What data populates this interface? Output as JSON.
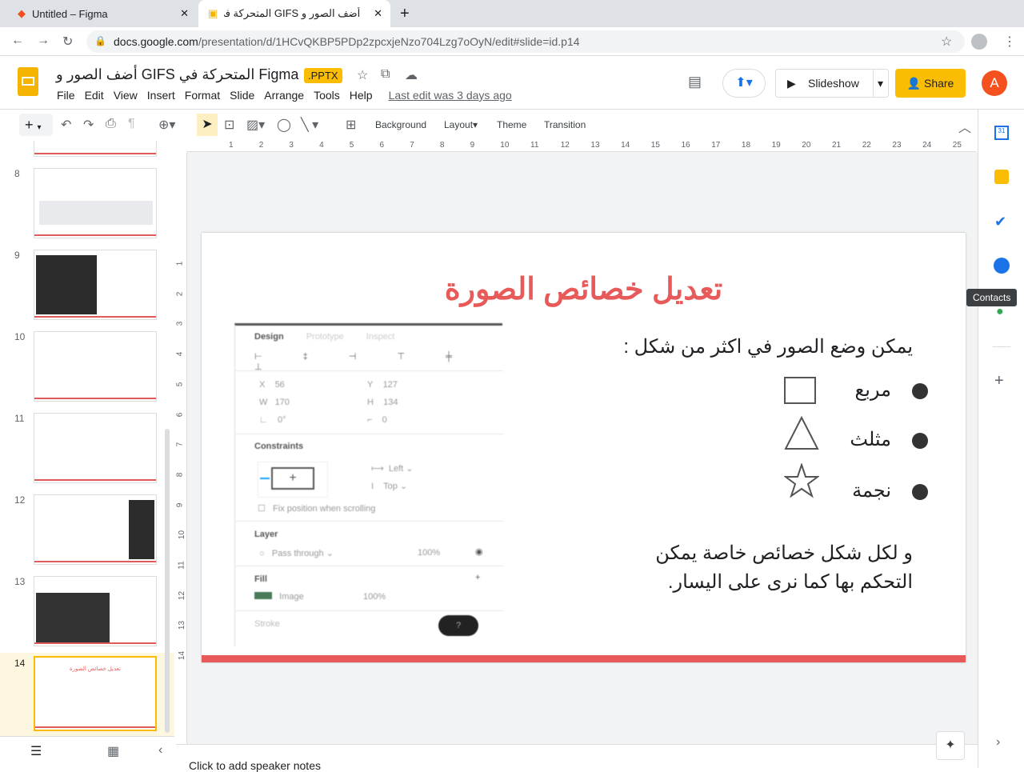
{
  "browser": {
    "tabs": [
      {
        "title": "Untitled – Figma",
        "active": false
      },
      {
        "title": "أضف الصور و GIFS المتحركة في",
        "active": true
      }
    ],
    "url_host": "docs.google.com",
    "url_path": "/presentation/d/1HCvQKBP5PDp2zpcxjeNzo704Lzg7oOyN/edit#slide=id.p14"
  },
  "doc": {
    "title": "أضف الصور و GIFS المتحركة في Figma",
    "badge": ".PPTX",
    "menus": [
      "File",
      "Edit",
      "View",
      "Insert",
      "Format",
      "Slide",
      "Arrange",
      "Tools",
      "Help"
    ],
    "last_edit": "Last edit was 3 days ago",
    "slideshow": "Slideshow",
    "share": "Share",
    "avatar": "A"
  },
  "toolbar": {
    "background": "Background",
    "layout": "Layout",
    "theme": "Theme",
    "transition": "Transition"
  },
  "ruler": [
    "1",
    "2",
    "3",
    "4",
    "5",
    "6",
    "7",
    "8",
    "9",
    "10",
    "11",
    "12",
    "13",
    "14",
    "15",
    "16",
    "17",
    "18",
    "19",
    "20",
    "21",
    "22",
    "23",
    "24",
    "25"
  ],
  "vruler": [
    "1",
    "2",
    "3",
    "4",
    "5",
    "6",
    "7",
    "8",
    "9",
    "10",
    "11",
    "12",
    "13",
    "14"
  ],
  "slides": [
    {
      "num": "8"
    },
    {
      "num": "9"
    },
    {
      "num": "10"
    },
    {
      "num": "11"
    },
    {
      "num": "12"
    },
    {
      "num": "13"
    },
    {
      "num": "14",
      "active": true
    }
  ],
  "slide": {
    "title": "تعديل خصائص الصورة",
    "intro": "يمكن وضع الصور في اكثر من شكل :",
    "bullets": [
      {
        "label": "مربع",
        "shape": "square"
      },
      {
        "label": "مثلث",
        "shape": "triangle"
      },
      {
        "label": "نجمة",
        "shape": "star"
      }
    ],
    "outro1": "و لكل شكل خصائص خاصة يمكن",
    "outro2": "التحكم بها كما نرى على اليسار.",
    "accent": "#e85a5a",
    "figma": {
      "tabs": [
        "Design",
        "Prototype",
        "Inspect"
      ],
      "x": "56",
      "y": "127",
      "w": "170",
      "h": "134",
      "rot": "0°",
      "radius": "0",
      "constraints": "Constraints",
      "h_con": "Left",
      "v_con": "Top",
      "fix": "Fix position when scrolling",
      "layer": "Layer",
      "blend": "Pass through",
      "layer_opacity": "100%",
      "fill": "Fill",
      "fill_type": "Image",
      "fill_opacity": "100%",
      "stroke": "Stroke",
      "help": "?"
    }
  },
  "notes": "Click to add speaker notes",
  "side": {
    "contacts_tooltip": "Contacts"
  }
}
